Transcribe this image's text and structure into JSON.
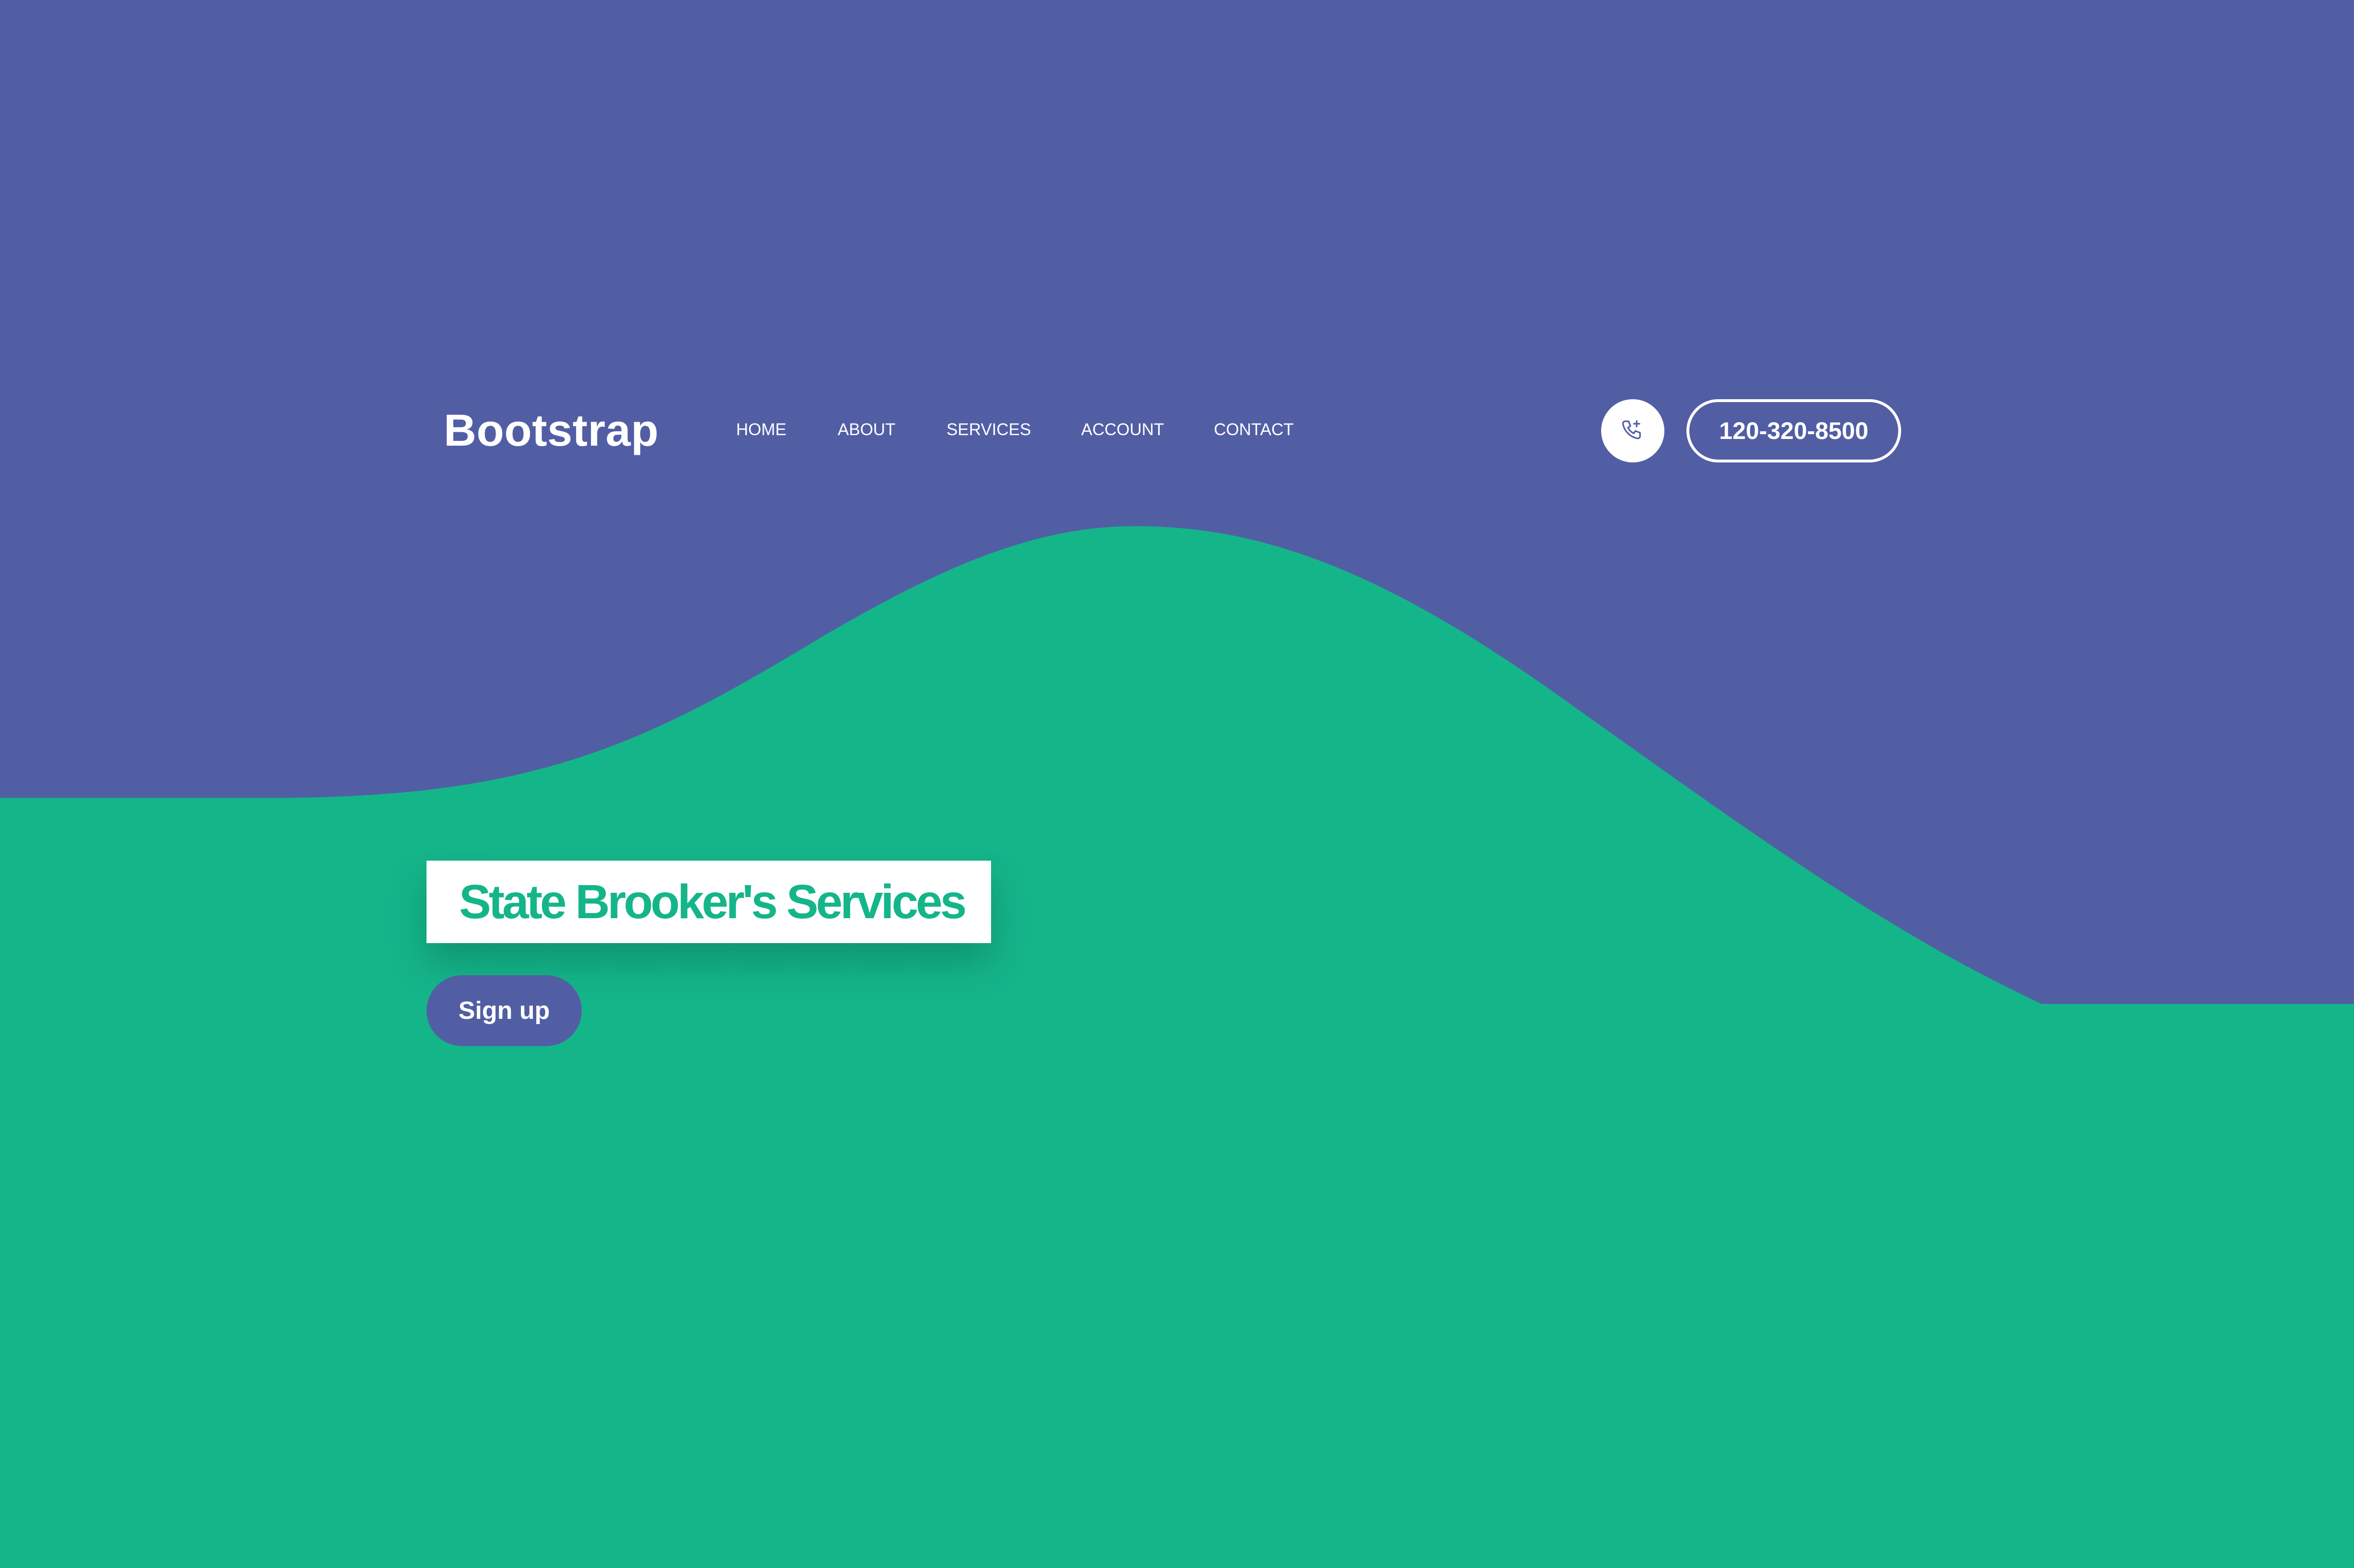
{
  "brand": {
    "name": "Bootstrap"
  },
  "nav": {
    "items": [
      {
        "label": "HOME"
      },
      {
        "label": "ABOUT"
      },
      {
        "label": "SERVICES"
      },
      {
        "label": "ACCOUNT"
      },
      {
        "label": "CONTACT"
      }
    ]
  },
  "contact": {
    "phone_icon": "phone-call-icon",
    "phone_number": "120-320-8500"
  },
  "hero": {
    "title": "State Brooker's Services",
    "cta_label": "Sign up"
  },
  "colors": {
    "primary_purple": "#525ea4",
    "accent_green": "#15b58a",
    "white": "#ffffff"
  }
}
